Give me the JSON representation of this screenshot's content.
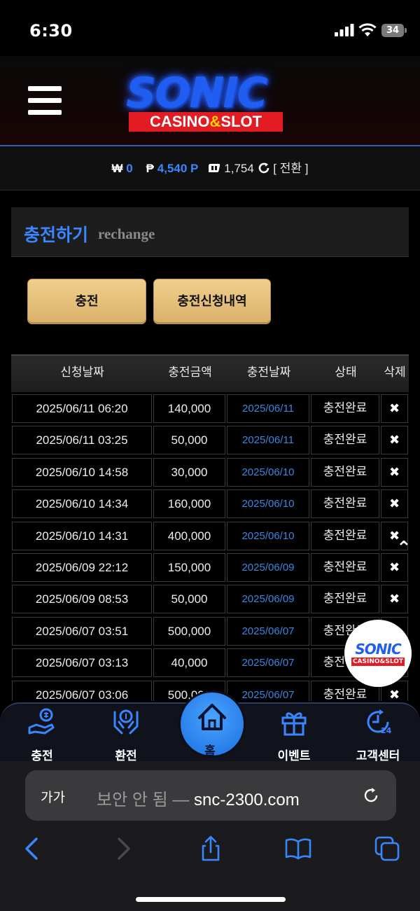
{
  "status_bar": {
    "time": "6:30",
    "battery": "34"
  },
  "header": {
    "logo_main": "SONIC",
    "logo_sub_a": "CASINO",
    "logo_amp": "&",
    "logo_sub_b": "SLOT"
  },
  "balance": {
    "won_symbol": "₩",
    "won_value": "0",
    "point_symbol": "₱",
    "point_value": "4,540 P",
    "chip_value": "1,754",
    "convert_label": "[ 전환 ]"
  },
  "page_title": {
    "korean": "충전하기",
    "english": "rechange"
  },
  "actions": {
    "charge_label": "충전",
    "history_label": "충전신청내역"
  },
  "table": {
    "headers": [
      "신청날짜",
      "충전금액",
      "충전날짜",
      "상태",
      "삭제"
    ],
    "rows": [
      {
        "requested": "2025/06/11 06:20",
        "amount": "140,000",
        "charged": "2025/06/11",
        "status": "충전완료",
        "delete": "✖"
      },
      {
        "requested": "2025/06/11 03:25",
        "amount": "50,000",
        "charged": "2025/06/11",
        "status": "충전완료",
        "delete": "✖"
      },
      {
        "requested": "2025/06/10 14:58",
        "amount": "30,000",
        "charged": "2025/06/10",
        "status": "충전완료",
        "delete": "✖"
      },
      {
        "requested": "2025/06/10 14:34",
        "amount": "160,000",
        "charged": "2025/06/10",
        "status": "충전완료",
        "delete": "✖"
      },
      {
        "requested": "2025/06/10 14:31",
        "amount": "400,000",
        "charged": "2025/06/10",
        "status": "충전완료",
        "delete": "✖"
      },
      {
        "requested": "2025/06/09 22:12",
        "amount": "150,000",
        "charged": "2025/06/09",
        "status": "충전완료",
        "delete": "✖"
      },
      {
        "requested": "2025/06/09 08:53",
        "amount": "50,000",
        "charged": "2025/06/09",
        "status": "충전완료",
        "delete": "✖"
      },
      {
        "requested": "2025/06/07 03:51",
        "amount": "500,000",
        "charged": "2025/06/07",
        "status": "충전완료",
        "delete": "✖"
      },
      {
        "requested": "2025/06/07 03:13",
        "amount": "40,000",
        "charged": "2025/06/07",
        "status": "충전완료",
        "delete": "✖"
      },
      {
        "requested": "2025/06/07 03:06",
        "amount": "500,000",
        "charged": "2025/06/07",
        "status": "충전완료",
        "delete": "✖"
      }
    ]
  },
  "floating": {
    "scroll_top": "⌃",
    "badge_main": "SONIC",
    "badge_sub": "CASINO&SLOT"
  },
  "bottom_nav": {
    "charge": "충전",
    "exchange": "환전",
    "home": "홈",
    "event": "이벤트",
    "support": "고객센터"
  },
  "browser": {
    "text_size": "가가",
    "insecure": "보안 안 됨 — ",
    "domain": "snc-2300.com"
  },
  "colors": {
    "accent_blue": "#3a86ff",
    "button_gold": "#e6c07a",
    "logo_red": "#e31b23"
  }
}
